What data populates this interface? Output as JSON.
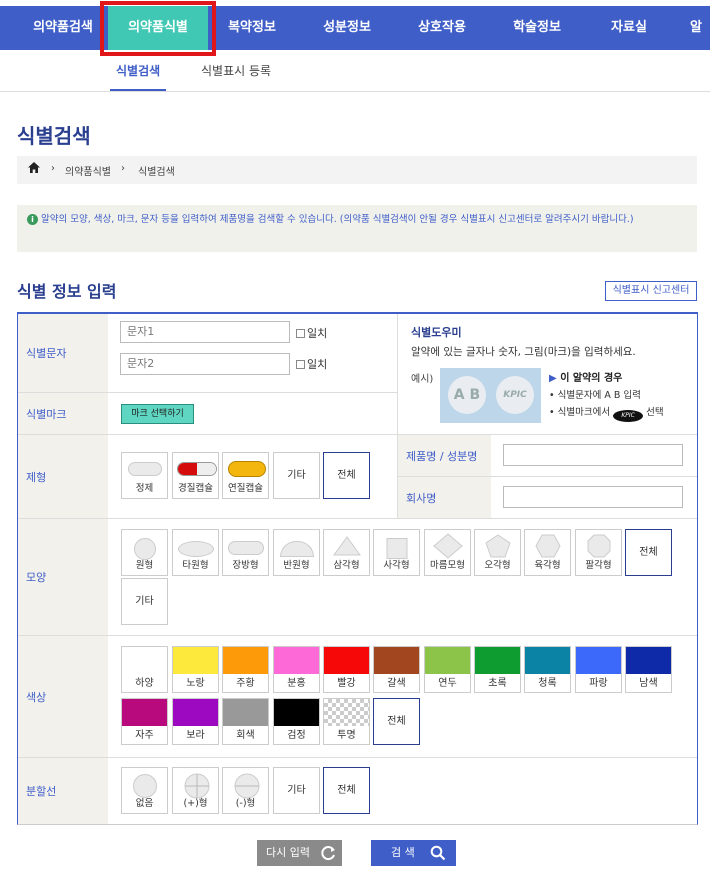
{
  "nav": {
    "items": [
      "의약품검색",
      "의약품식별",
      "복약정보",
      "성분정보",
      "상호작용",
      "학술정보",
      "자료실",
      "알"
    ],
    "active_index": 1
  },
  "subnav": {
    "items": [
      "식별검색",
      "식별표시 등록"
    ]
  },
  "page_title": "식별검색",
  "breadcrumb": [
    "의약품식별",
    "식별검색"
  ],
  "notice": "알약의 모양, 색상, 마크, 문자 등을 입력하여 제품명을 검색할 수 있습니다. (의약품 식별검색이 안될 경우 식별표시 신고센터로 알려주시기 바랍니다.)",
  "section_title": "식별 정보 입력",
  "report_center": "식별표시 신고센터",
  "form": {
    "label_chars": "식별문자",
    "label_mark": "식별마크",
    "input1_placeholder": "문자1",
    "input2_placeholder": "문자2",
    "match_label": "일치",
    "mark_button": "마크 선택하기",
    "label_form": "제형",
    "label_product": "제품명 / 성분명",
    "label_company": "회사명",
    "label_shape": "모양",
    "label_color": "색상",
    "label_split": "분할선"
  },
  "help": {
    "title": "식별도우미",
    "desc": "알약에 있는 글자나 숫자, 그림(마크)을 입력하세요.",
    "example": "예시)",
    "pill_text_1": "A B",
    "pill_text_2": "KPIC",
    "case_title": "이 알약의 경우",
    "step1": "• 식별문자에 A B 입력",
    "step2_pre": "• 식별마크에서",
    "step2_post": "선택",
    "kpic": "KPIC"
  },
  "forms": [
    "정제",
    "경질캡슐",
    "연질캡슐",
    "기타",
    "전체"
  ],
  "shapes": [
    "원형",
    "타원형",
    "장방형",
    "반원형",
    "삼각형",
    "사각형",
    "마름모형",
    "오각형",
    "육각형",
    "팔각형",
    "전체",
    "기타"
  ],
  "colors": [
    {
      "name": "하양",
      "hex": "#ffffff"
    },
    {
      "name": "노랑",
      "hex": "#fde83c"
    },
    {
      "name": "주황",
      "hex": "#fd9a0a"
    },
    {
      "name": "분홍",
      "hex": "#fd6ad7"
    },
    {
      "name": "빨강",
      "hex": "#f70808"
    },
    {
      "name": "갈색",
      "hex": "#a2461f"
    },
    {
      "name": "연두",
      "hex": "#8cc349"
    },
    {
      "name": "초록",
      "hex": "#0e9c30"
    },
    {
      "name": "청록",
      "hex": "#0a83a5"
    },
    {
      "name": "파랑",
      "hex": "#3d69fa"
    },
    {
      "name": "남색",
      "hex": "#0e2aa8"
    },
    {
      "name": "자주",
      "hex": "#b80a7c"
    },
    {
      "name": "보라",
      "hex": "#9d08c1"
    },
    {
      "name": "회색",
      "hex": "#999999"
    },
    {
      "name": "검정",
      "hex": "#000000"
    },
    {
      "name": "투명",
      "hex": "transparent"
    },
    {
      "name": "전체",
      "hex": ""
    }
  ],
  "splits": [
    "없음",
    "(+)형",
    "(-)형",
    "기타",
    "전체"
  ],
  "buttons": {
    "reset": "다시 입력",
    "search": "검 색"
  }
}
